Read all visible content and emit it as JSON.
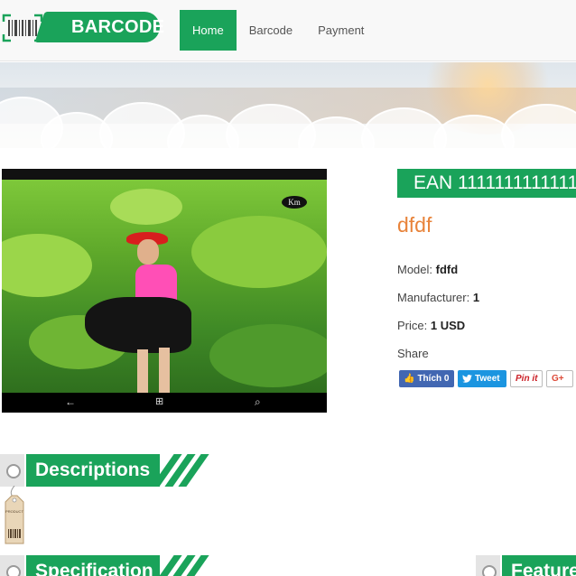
{
  "brand": {
    "name": "BARCODE",
    "accent_color": "#1aa35a",
    "logo_icon": "barcode-scanner-icon"
  },
  "nav": {
    "items": [
      {
        "label": "Home",
        "active": true
      },
      {
        "label": "Barcode",
        "active": false
      },
      {
        "label": "Payment",
        "active": false
      }
    ]
  },
  "product": {
    "ean_label": "EAN 1111111111111",
    "name": "dfdf",
    "name_color": "#e8833a",
    "model_label": "Model:",
    "model_value": "fdfd",
    "manufacturer_label": "Manufacturer:",
    "manufacturer_value": "1",
    "price_label": "Price:",
    "price_value": "1 USD",
    "image_watermark": "Km"
  },
  "share": {
    "label": "Share",
    "facebook": "Thích 0",
    "twitter": "Tweet",
    "pinterest": "Pin it",
    "google_plus": "G+"
  },
  "sections": {
    "descriptions": "Descriptions",
    "specification": "Specification",
    "features": "Feature",
    "tag_text": "PRODUCT"
  }
}
